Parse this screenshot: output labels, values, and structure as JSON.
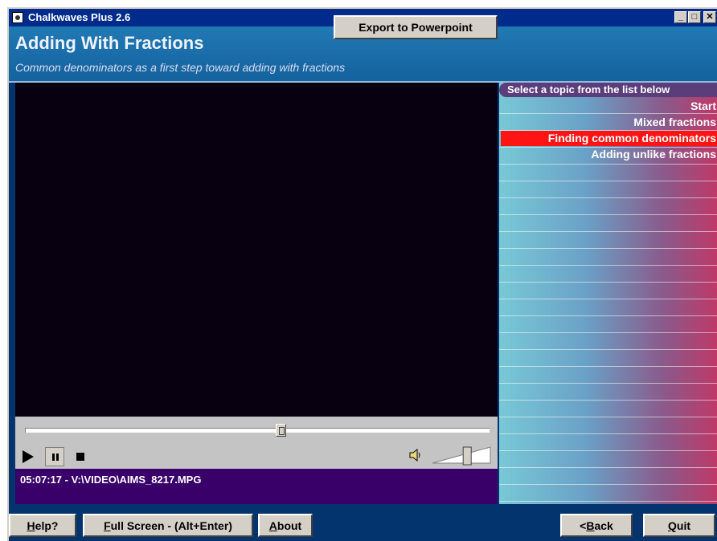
{
  "window": {
    "title": "Chalkwaves Plus 2.6",
    "controls": {
      "minimize": "_",
      "maximize": "□",
      "close": "✕"
    }
  },
  "header": {
    "title": "Adding With Fractions",
    "subtitle": "Common denominators as a first step toward adding with fractions"
  },
  "player": {
    "seek_position_fraction": 0.55,
    "volume_fraction": 0.6,
    "icons": [
      "play-icon",
      "pause-icon",
      "stop-icon",
      "speaker-icon"
    ],
    "status": "05:07:17 - V:\\VIDEO\\AIMS_8217.MPG",
    "export_label": "Export to Powerpoint"
  },
  "topics": {
    "header": "Select a topic from the list below",
    "items": [
      {
        "label": "Start",
        "selected": false
      },
      {
        "label": "Mixed fractions",
        "selected": false
      },
      {
        "label": "Finding common denominators",
        "selected": true
      },
      {
        "label": "Adding unlike fractions",
        "selected": false
      }
    ]
  },
  "buttons": {
    "help": {
      "mnemonic": "H",
      "rest": "elp?"
    },
    "fullscreen": {
      "mnemonic": "F",
      "rest": "ull Screen - (Alt+Enter)"
    },
    "about": {
      "mnemonic": "A",
      "rest": "bout"
    },
    "back": {
      "prefix": "< ",
      "mnemonic": "B",
      "rest": "ack"
    },
    "quit": {
      "mnemonic": "Q",
      "rest": "uit"
    }
  },
  "colors": {
    "titlebar": "#002b8c",
    "header": "#2179b4",
    "video_bg": "#080010",
    "status_bg": "#3a006a",
    "selected_topic": "#ff1414",
    "window_bg": "#04346e"
  }
}
